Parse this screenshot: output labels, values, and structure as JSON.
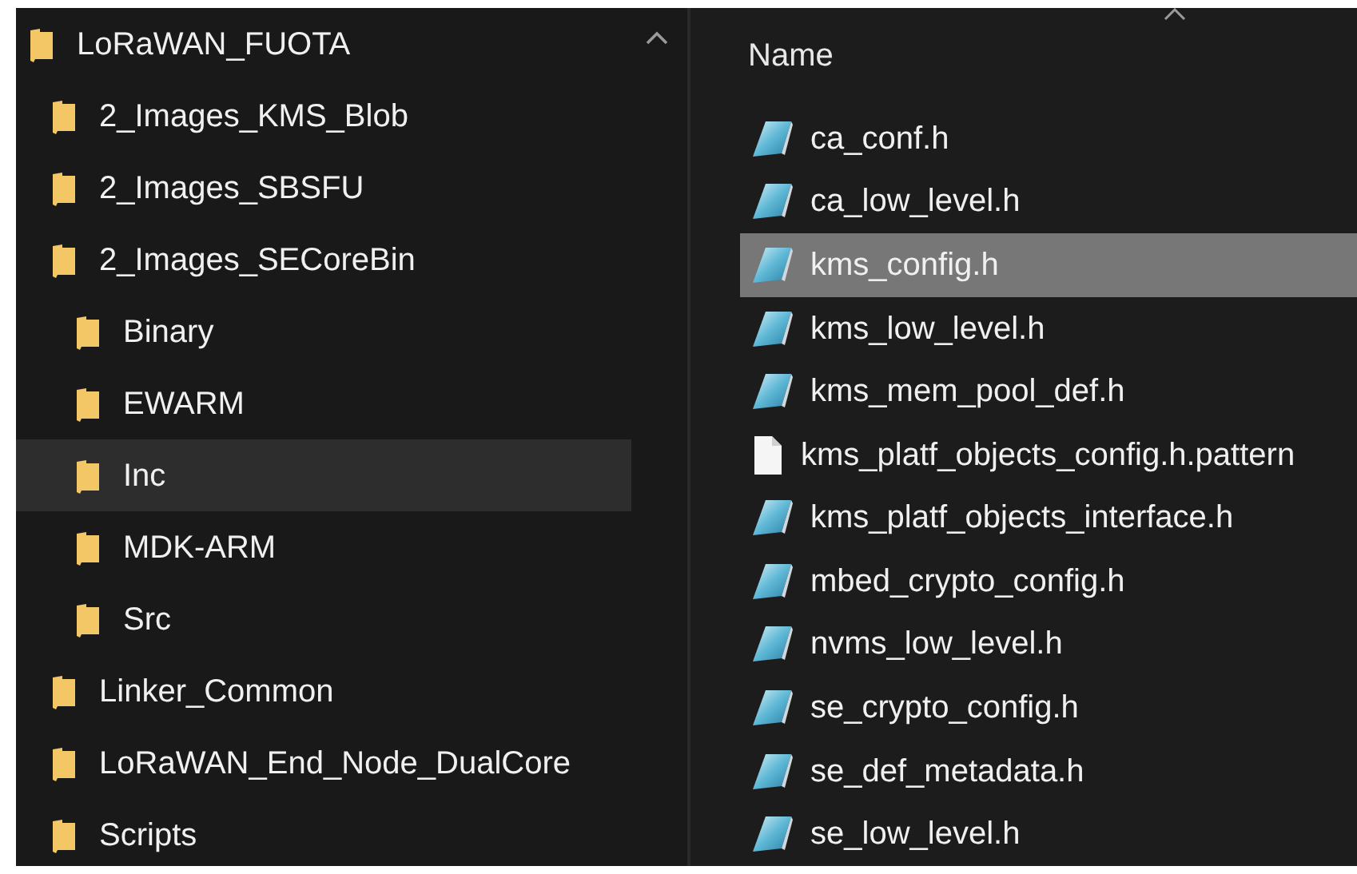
{
  "tree": [
    {
      "label": "LoRaWAN_FUOTA",
      "selected": false,
      "expanded": true,
      "children": [
        {
          "label": "2_Images_KMS_Blob",
          "selected": false
        },
        {
          "label": "2_Images_SBSFU",
          "selected": false
        },
        {
          "label": "2_Images_SECoreBin",
          "selected": false,
          "children": [
            {
              "label": "Binary",
              "selected": false
            },
            {
              "label": "EWARM",
              "selected": false
            },
            {
              "label": "Inc",
              "selected": true
            },
            {
              "label": "MDK-ARM",
              "selected": false
            },
            {
              "label": "Src",
              "selected": false
            }
          ]
        },
        {
          "label": "Linker_Common",
          "selected": false
        },
        {
          "label": "LoRaWAN_End_Node_DualCore",
          "selected": false
        },
        {
          "label": "Scripts",
          "selected": false
        }
      ]
    }
  ],
  "file_list": {
    "column_header": "Name",
    "files": [
      {
        "name": "ca_conf.h",
        "kind": "header",
        "selected": false
      },
      {
        "name": "ca_low_level.h",
        "kind": "header",
        "selected": false
      },
      {
        "name": "kms_config.h",
        "kind": "header",
        "selected": true
      },
      {
        "name": "kms_low_level.h",
        "kind": "header",
        "selected": false
      },
      {
        "name": "kms_mem_pool_def.h",
        "kind": "header",
        "selected": false
      },
      {
        "name": "kms_platf_objects_config.h.pattern",
        "kind": "plain",
        "selected": false
      },
      {
        "name": "kms_platf_objects_interface.h",
        "kind": "header",
        "selected": false
      },
      {
        "name": "mbed_crypto_config.h",
        "kind": "header",
        "selected": false
      },
      {
        "name": "nvms_low_level.h",
        "kind": "header",
        "selected": false
      },
      {
        "name": "se_crypto_config.h",
        "kind": "header",
        "selected": false
      },
      {
        "name": "se_def_metadata.h",
        "kind": "header",
        "selected": false
      },
      {
        "name": "se_low_level.h",
        "kind": "header",
        "selected": false
      }
    ]
  }
}
